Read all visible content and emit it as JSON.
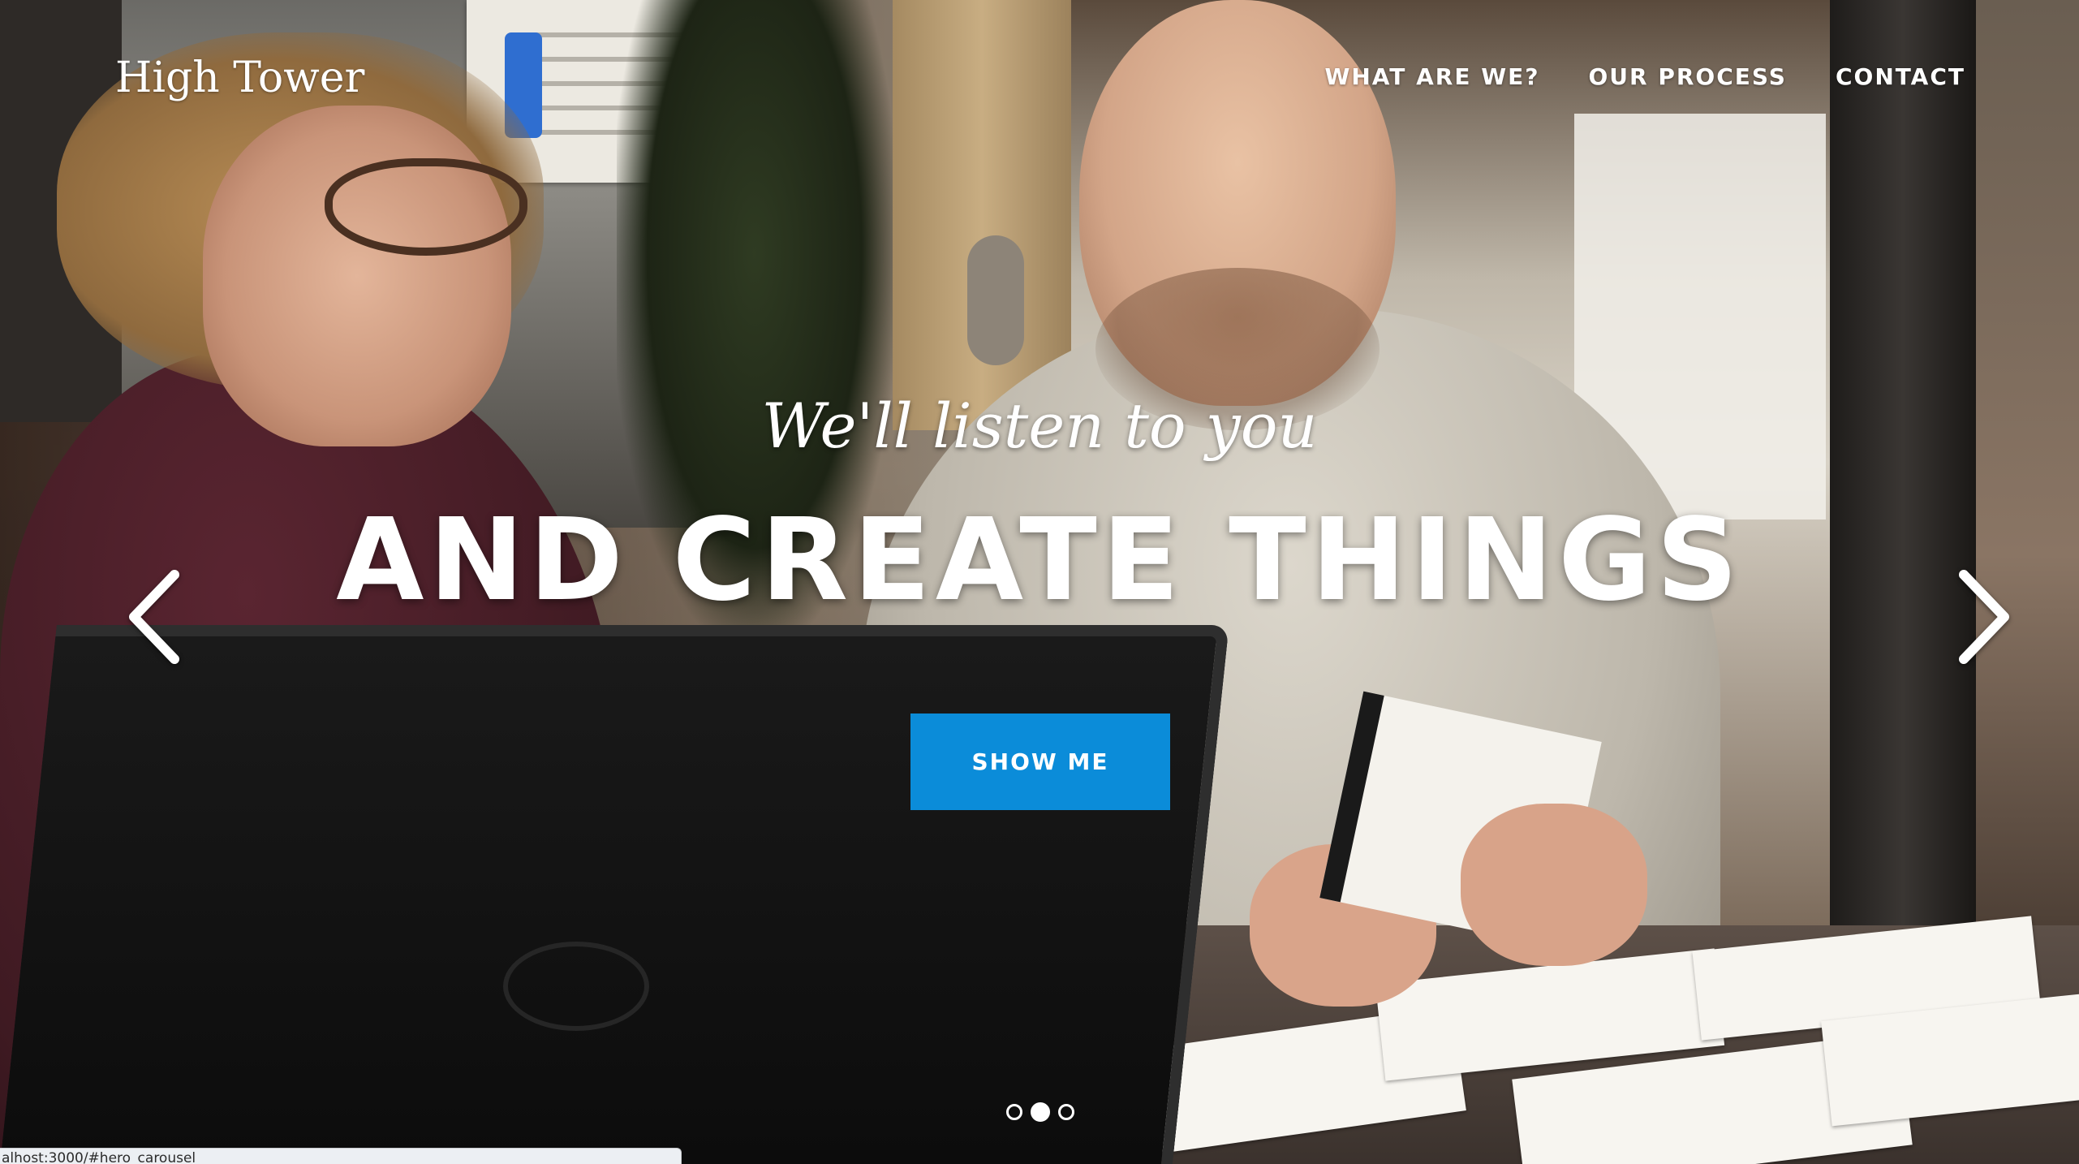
{
  "brand": {
    "name": "High Tower"
  },
  "nav": {
    "items": [
      {
        "label": "WHAT ARE WE?"
      },
      {
        "label": "OUR PROCESS"
      },
      {
        "label": "CONTACT"
      }
    ]
  },
  "hero": {
    "subtitle": "We'll listen to you",
    "headline": "AND CREATE THINGS",
    "cta_label": "SHOW ME",
    "cta_color": "#0b8cd9",
    "prev_icon": "chevron-left-icon",
    "next_icon": "chevron-right-icon",
    "indicators": {
      "count": 3,
      "active_index": 1
    }
  },
  "status_bar": {
    "url": "alhost:3000/#hero_carousel"
  }
}
